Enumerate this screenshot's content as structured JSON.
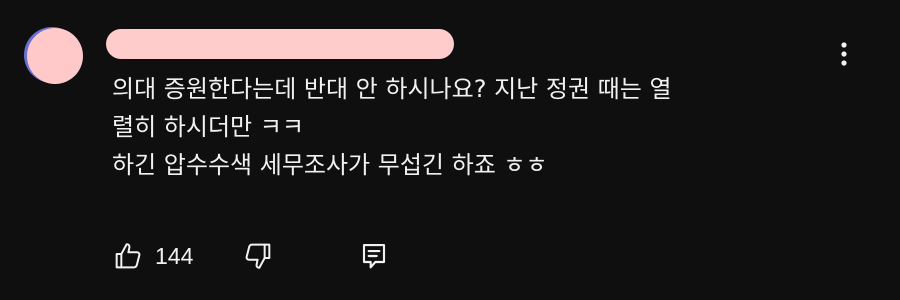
{
  "comment": {
    "lines": [
      "의대 증원한다는데 반대 안 하시나요? 지난 정권 때는 열",
      "렬히 하시더만 ㅋㅋ",
      "하긴 압수수색 세무조사가 무섭긴 하죠 ㅎㅎ"
    ],
    "like_count": "144"
  },
  "icons": {
    "like": "thumbs-up-icon",
    "dislike": "thumbs-down-icon",
    "reply": "reply-comment-icon",
    "more": "more-vertical-icon"
  },
  "colors": {
    "background": "#0f0f0f",
    "text": "#f1f1f1",
    "avatar": "#ffc9c9",
    "avatar_ring": "#6a6fd0",
    "author_redaction": "#ffcccc"
  }
}
